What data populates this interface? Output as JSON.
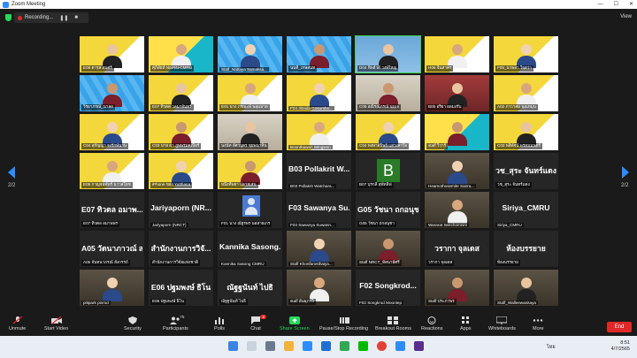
{
  "window": {
    "title": "Zoom Meeting",
    "minimize": "—",
    "maximize": "☐",
    "close": "✕"
  },
  "topbar": {
    "recording_label": "Recording...",
    "pause": "❚❚",
    "stop": "■",
    "view_label": "View"
  },
  "pager": {
    "left": "2/2",
    "right": "2/2"
  },
  "tiles": [
    {
      "label": "E09 ดารุส สมศรี",
      "style": "yellow"
    },
    {
      "label": "ศุภิสัยห์ ฟองจน-CMRU",
      "style": "teal"
    },
    {
      "label": "Staff_Nattaya Samaksa...",
      "style": "blue"
    },
    {
      "label": "นนทิ์_เกษสนท",
      "style": "blue"
    },
    {
      "label": "D04 ทิพย์วดี วงษ์ใหญ่",
      "style": "bluewall",
      "speaking": true
    },
    {
      "label": "H06 จีนสาคร",
      "style": "yellow"
    },
    {
      "label": "F09_นวพลา ใจสว่า",
      "style": "yellow"
    },
    {
      "label": "วิรยาภรณ์_นาลอ",
      "style": "blue"
    },
    {
      "label": "E07 ทิวตต วลมาจันทร์",
      "style": "yellow"
    },
    {
      "label": "E01 นาง ภรณะษ์ พลุมมาต",
      "style": "yellow"
    },
    {
      "label": "F04 Jitrada Gosumbo...",
      "style": "yellow"
    },
    {
      "label": "C06 อณิรณ์ภรณ์ นุบุเจ",
      "style": "room"
    },
    {
      "label": "B05 อริยา ผลมงรับ",
      "style": "red"
    },
    {
      "label": "A02 ภาวาสม นุณหมุน",
      "style": "yellow"
    },
    {
      "label": "C04 สุกัญญา จงรักษ์นาน",
      "style": "yellow"
    },
    {
      "label": "C03 นาย ผา ภูพพรมคเปี้ยร์",
      "style": "yellow"
    },
    {
      "label": "นงนัท อัศวบุตร ขุยพนาทิน",
      "style": "room"
    },
    {
      "label": "Boonthawan Wingwon",
      "style": "yellow"
    },
    {
      "label": "C04 พงษาสัธิพย์ แสวงสาใจ",
      "style": "yellow"
    },
    {
      "label": "staff วิวาร์",
      "style": "teal"
    },
    {
      "label": "C02 พลิพัจน์ พรหมมนตรี",
      "style": "yellow"
    },
    {
      "label": "E05 กาญจนพัทร์ นาวสโยช",
      "style": "yellow"
    },
    {
      "label": "iPhone ของ Yutthana",
      "style": "yellow"
    },
    {
      "label": "หนึ่งทีพยา ปลายเสน",
      "style": "yellow"
    },
    {
      "label": "B03 Pollakrit Watchara...",
      "big": "B03 Pollakrit W...",
      "style": "dark"
    },
    {
      "label": "B07 บุรกลี สุพัทลิฟ",
      "letter": "B",
      "style": "dark"
    },
    {
      "label": "Heamothosemite Sanra...",
      "style": "photo"
    },
    {
      "label": "วช_สุระ จันทร์แดง",
      "big": "วช_สุระ จันทร์แดง",
      "style": "dark"
    },
    {
      "label": "E07 ทิวตล อมาพพร",
      "big": "E07 ทิวตล อมาพ...",
      "style": "dark"
    },
    {
      "label": "Jariyaporn (NRCT)",
      "big": "Jariyaporn (NR...",
      "style": "dark"
    },
    {
      "label": "F01 นาง ณัฐรพร นอสายเกร",
      "avatar": true,
      "style": "dark"
    },
    {
      "label": "F03 Sawanya Suwann...",
      "big": "F03 Sawanya Su...",
      "style": "dark"
    },
    {
      "label": "G05 วัชนา ถกอนุชา",
      "big": "G05 วัชนา ถกอนุชา",
      "style": "dark"
    },
    {
      "label": "Wararat Seechomnim",
      "style": "photo"
    },
    {
      "label": "Siriya_CMRU",
      "big": "Siriya_CMRU",
      "style": "dark"
    },
    {
      "label": "A05 จันทนาภรณ์ สังกรรถ์",
      "big": "A05 วัตนาภาวณ์ ส...",
      "style": "dark"
    },
    {
      "label": "สำนักงานการวิจัยแห่งชาติ",
      "big": "สำนักงานการวิจั...",
      "style": "dark"
    },
    {
      "label": "Kannika Sasong CMRU",
      "big": "Kannika Sasong...",
      "style": "dark"
    },
    {
      "label": "Staff Khonfarosthaiya...",
      "style": "photo"
    },
    {
      "label": "Staff NRCT_หัสนาย์ศรี",
      "style": "photo"
    },
    {
      "label": "วรากา จุลเดส",
      "big": "วรากา จุลเดส",
      "style": "dark"
    },
    {
      "label": "ห้องบรรยาย",
      "big": "ห้องบรรยาย",
      "style": "dark"
    },
    {
      "label": "pitipark pinrod",
      "style": "photo"
    },
    {
      "label": "E06 ปฐมพงษ์ ธิโน",
      "big": "E06 ปฐมพงษ์ ธิโน",
      "style": "dark"
    },
    {
      "label": "ณัฐฐนันท์ ไปธิ",
      "big": "ณัฐฐนันท์ ไปธิ",
      "style": "dark"
    },
    {
      "label": "staff อันธุภาวิ",
      "style": "photo"
    },
    {
      "label": "F02 Songkrod Moontep",
      "big": "F02 Songkrod...",
      "style": "dark"
    },
    {
      "label": "Staff ประภาพร",
      "style": "photo"
    },
    {
      "label": "Staff_Walleewanitaya",
      "style": "photo"
    }
  ],
  "toolbar": {
    "unmute": "Unmute",
    "start_video": "Start Video",
    "security": "Security",
    "participants": "Participants",
    "participants_count": "75",
    "polls": "Polls",
    "chat": "Chat",
    "chat_badge": "2",
    "share_screen": "Share Screen",
    "pause_stop_recording": "Pause/Stop Recording",
    "breakout_rooms": "Breakout Rooms",
    "reactions": "Reactions",
    "apps": "Apps",
    "whiteboards": "Whiteboards",
    "more": "More",
    "end": "End"
  },
  "taskbar": {
    "lang": "ไทย",
    "time": "8:51",
    "date": "4/7/2565"
  },
  "colors": {
    "zoom_blue": "#2d8cff",
    "end_red": "#e02828",
    "share_green": "#23d959"
  }
}
